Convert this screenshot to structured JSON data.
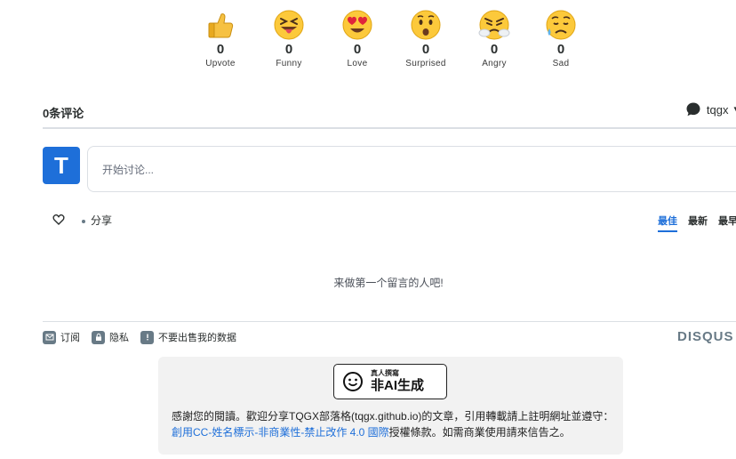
{
  "reactions": [
    {
      "name": "Upvote",
      "count": "0",
      "icon": "thumbs-up-icon"
    },
    {
      "name": "Funny",
      "count": "0",
      "icon": "squinting-tongue-face-icon"
    },
    {
      "name": "Love",
      "count": "0",
      "icon": "heart-eyes-face-icon"
    },
    {
      "name": "Surprised",
      "count": "0",
      "icon": "hushed-face-icon"
    },
    {
      "name": "Angry",
      "count": "0",
      "icon": "steam-face-icon"
    },
    {
      "name": "Sad",
      "count": "0",
      "icon": "sad-sweat-face-icon"
    }
  ],
  "header": {
    "comment_count": "0条评论",
    "username": "tqgx"
  },
  "composer": {
    "avatar_letter": "T",
    "placeholder": "开始讨论..."
  },
  "actions": {
    "share_label": "分享",
    "sort_tabs": [
      "最佳",
      "最新",
      "最早"
    ]
  },
  "empty_message": "来做第一个留言的人吧!",
  "footer": {
    "subscribe": "订阅",
    "privacy": "隐私",
    "do_not_sell": "不要出售我的数据",
    "brand": "DISQUS"
  },
  "license": {
    "badge_small": "真人撰寫",
    "badge_big": "非AI生成",
    "text_before": "感謝您的閱讀。歡迎分享TQGX部落格(tqgx.github.io)的文章，引用轉載請上註明網址並遵守：",
    "link_text": "創用CC-姓名標示-非商業性-禁止改作 4.0 國際",
    "text_after": "授權條款。如需商業使用請來信告之。"
  },
  "colors": {
    "accent": "#1e6fd9",
    "muted": "#687a86",
    "divider": "#dbdfe4"
  }
}
